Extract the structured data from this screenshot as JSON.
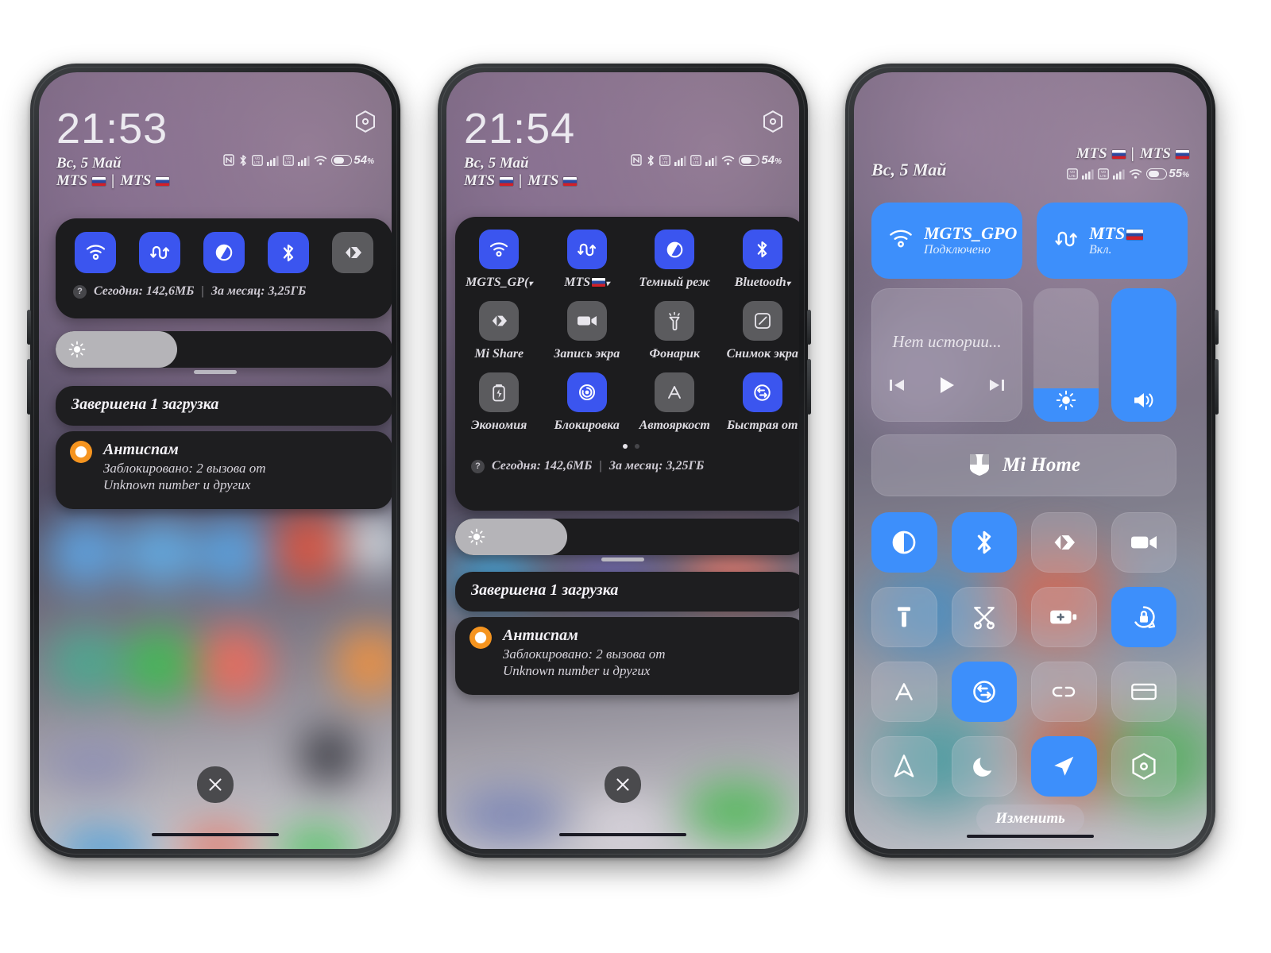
{
  "meta": {
    "accent_blue": "#3b55ef",
    "cc_blue": "#3d8ffb",
    "panel_bg": "#1c1c1e"
  },
  "phone1": {
    "status": {
      "time": "21:53",
      "date": "Вс, 5 Май",
      "carrier1": "MTS",
      "carrier_sep": "|",
      "carrier2": "MTS",
      "battery_percent": "54",
      "battery_unit": "%",
      "icons": [
        "nfc-icon",
        "bluetooth-icon",
        "sim1-signal-icon",
        "signal-bars-icon",
        "sim2-signal-icon",
        "signal-bars-icon",
        "wifi-icon",
        "battery-icon"
      ]
    },
    "gear": "settings-gear-icon",
    "toggles": [
      {
        "name": "wifi",
        "icon": "wifi-icon",
        "state": "on"
      },
      {
        "name": "mobile-data",
        "icon": "mobile-data-icon",
        "state": "on"
      },
      {
        "name": "dark-mode",
        "icon": "dark-mode-icon",
        "state": "on"
      },
      {
        "name": "bluetooth",
        "icon": "bluetooth-icon",
        "state": "on"
      },
      {
        "name": "mi-share",
        "icon": "mi-share-icon",
        "state": "off"
      }
    ],
    "data_usage": {
      "help": "?",
      "today": "Сегодня: 142,6МБ",
      "divider": "|",
      "month": "За месяц: 3,25ГБ"
    },
    "brightness": {
      "icon": "brightness-icon",
      "percent": 36
    },
    "notifications": [
      {
        "type": "summary",
        "title": "Завершена 1 загрузка"
      },
      {
        "type": "app",
        "app": "Антиспам",
        "icon": "antispam-icon",
        "line1": "Заблокировано: 2 вызова от",
        "line2": "Unknown number и других"
      }
    ],
    "close_button": "close-icon"
  },
  "phone2": {
    "status": {
      "time": "21:54",
      "date": "Вс, 5 Май",
      "carrier1": "MTS",
      "carrier_sep": "|",
      "carrier2": "MTS",
      "battery_percent": "54",
      "battery_unit": "%"
    },
    "gear": "settings-gear-icon",
    "tiles": [
      {
        "label": "MGTS_GP(",
        "icon": "wifi-icon",
        "state": "on",
        "chevron": true
      },
      {
        "label": "MTS",
        "icon": "mobile-data-icon",
        "state": "on",
        "chevron": true,
        "flag": true
      },
      {
        "label": "Темный реж",
        "icon": "dark-mode-icon",
        "state": "on",
        "chevron": false
      },
      {
        "label": "Bluetooth",
        "icon": "bluetooth-icon",
        "state": "on",
        "chevron": true
      },
      {
        "label": "Mi Share",
        "icon": "mi-share-icon",
        "state": "off",
        "chevron": false
      },
      {
        "label": "Запись экра",
        "icon": "screen-record-icon",
        "state": "off",
        "chevron": false
      },
      {
        "label": "Фонарик",
        "icon": "flashlight-icon",
        "state": "off",
        "chevron": false
      },
      {
        "label": "Снимок экра",
        "icon": "screenshot-icon",
        "state": "off",
        "chevron": false
      },
      {
        "label": "Экономия",
        "icon": "battery-saver-icon",
        "state": "off",
        "chevron": false
      },
      {
        "label": "Блокировка",
        "icon": "rotation-lock-icon",
        "state": "on",
        "chevron": false
      },
      {
        "label": "Автояркост",
        "icon": "auto-brightness-icon",
        "state": "off",
        "chevron": false
      },
      {
        "label": "Быстрая от",
        "icon": "quick-reply-icon",
        "state": "on",
        "chevron": false
      }
    ],
    "pager": {
      "pages": 2,
      "active": 0
    },
    "data_usage": {
      "help": "?",
      "today": "Сегодня: 142,6МБ",
      "divider": "|",
      "month": "За месяц: 3,25ГБ"
    },
    "brightness": {
      "icon": "brightness-icon",
      "percent": 32
    },
    "notifications": [
      {
        "type": "summary",
        "title": "Завершена 1 загрузка"
      },
      {
        "type": "app",
        "app": "Антиспам",
        "icon": "antispam-icon",
        "line1": "Заблокировано: 2 вызова от",
        "line2": "Unknown number и других"
      }
    ],
    "close_button": "close-icon"
  },
  "phone3": {
    "status": {
      "date": "Вс, 5 Май",
      "carrier1": "MTS",
      "carrier_sep": "|",
      "carrier2": "MTS",
      "battery_percent": "55",
      "battery_unit": "%"
    },
    "wifi_tile": {
      "icon": "wifi-icon",
      "title": "MGTS_GPO",
      "subtitle": "Подключено",
      "state": "on"
    },
    "data_tile": {
      "icon": "mobile-data-icon",
      "title": "MTS",
      "subtitle": "Вкл.",
      "state": "on",
      "flag": true
    },
    "player": {
      "placeholder": "Нет истории...",
      "prev": "previous-track-icon",
      "play": "play-icon",
      "next": "next-track-icon"
    },
    "brightness_slider": {
      "icon": "brightness-icon",
      "percent": 25
    },
    "volume_slider": {
      "icon": "volume-icon",
      "percent": 100
    },
    "mi_home": {
      "icon": "mi-home-icon",
      "label": "Mi Home"
    },
    "icon_grid": [
      {
        "name": "dark-mode",
        "icon": "dark-mode-icon",
        "state": "on"
      },
      {
        "name": "bluetooth",
        "icon": "bluetooth-icon",
        "state": "on"
      },
      {
        "name": "mi-share",
        "icon": "mi-share-icon",
        "state": "off"
      },
      {
        "name": "screen-record",
        "icon": "screen-record-icon",
        "state": "off"
      },
      {
        "name": "flashlight",
        "icon": "flashlight-icon",
        "state": "off"
      },
      {
        "name": "screenshot-scissors",
        "icon": "scissors-icon",
        "state": "off"
      },
      {
        "name": "battery-saver",
        "icon": "battery-plus-icon",
        "state": "off"
      },
      {
        "name": "rotation-lock",
        "icon": "rotation-lock-icon",
        "state": "on"
      },
      {
        "name": "auto-brightness",
        "icon": "auto-brightness-icon",
        "state": "off"
      },
      {
        "name": "quick-reply",
        "icon": "quick-reply-icon",
        "state": "on"
      },
      {
        "name": "cast-link",
        "icon": "link-icon",
        "state": "off"
      },
      {
        "name": "wallet",
        "icon": "wallet-card-icon",
        "state": "off"
      },
      {
        "name": "navigation",
        "icon": "navigation-arrow-icon",
        "state": "off"
      },
      {
        "name": "do-not-disturb",
        "icon": "moon-icon",
        "state": "off"
      },
      {
        "name": "location",
        "icon": "location-send-icon",
        "state": "on"
      },
      {
        "name": "settings",
        "icon": "settings-gear-icon",
        "state": "off"
      }
    ],
    "edit_button": "Изменить"
  }
}
